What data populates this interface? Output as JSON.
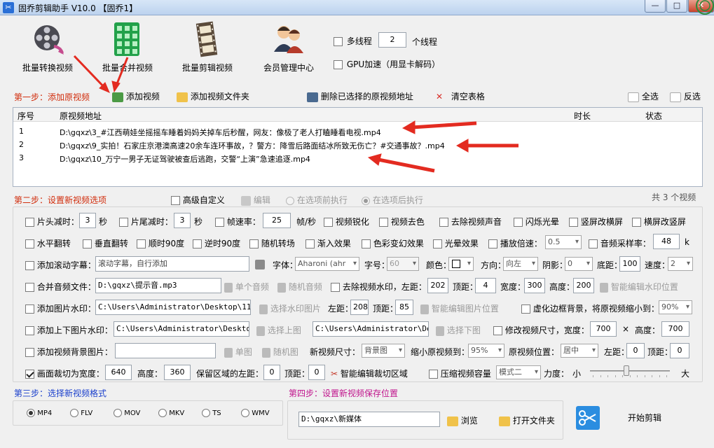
{
  "window": {
    "title": "固乔剪辑助手 V10.0  【固乔1】"
  },
  "toolbar": {
    "batch_convert": "批量转换视频",
    "batch_merge": "批量合并视频",
    "batch_edit": "批量剪辑视频",
    "member_center": "会员管理中心",
    "multithread_label": "多线程",
    "thread_count": "2",
    "thread_unit": "个线程",
    "gpu_label": "GPU加速（用显卡解码）"
  },
  "step1": {
    "title": "第一步：添加原视频",
    "add_video": "添加视频",
    "add_folder": "添加视频文件夹",
    "delete_selected": "删除已选择的原视频地址",
    "clear_table": "清空表格",
    "select_all": "全选",
    "invert": "反选"
  },
  "table": {
    "headers": {
      "index": "序号",
      "path": "原视频地址",
      "duration": "时长",
      "status": "状态"
    },
    "rows": [
      {
        "index": "1",
        "path": "D:\\gqxz\\3_#江西萌娃坐摇摇车睡着妈妈关掉车后秒醒，网友：像极了老人打瞌睡看电视.mp4",
        "duration": "",
        "status": ""
      },
      {
        "index": "2",
        "path": "D:\\gqxz\\9_实拍！石家庄京港澳高速20余车连环事故，？警方：降雪后路面结冰所致无伤亡？#交通事故？.mp4",
        "duration": "",
        "status": ""
      },
      {
        "index": "3",
        "path": "D:\\gqxz\\10_万宁一男子无证驾驶被查后逃跑，交警“上演”急速追逐.mp4",
        "duration": "",
        "status": ""
      }
    ]
  },
  "step2": {
    "title": "第二步：设置新视频选项",
    "advanced": "高级自定义",
    "edit": "编辑",
    "before": "在选项前执行",
    "after": "在选项后执行",
    "total": "共 3 个视频"
  },
  "options": {
    "head_cut": "片头减时：",
    "head_val": "3",
    "sec1": "秒",
    "tail_cut": "片尾减时：",
    "tail_val": "3",
    "sec2": "秒",
    "fps": "帧速率：",
    "fps_val": "25",
    "fps_unit": "帧/秒",
    "sharpen": "视频锐化",
    "decolor": "视频去色",
    "remove_audio": "去除视频声音",
    "flash": "闪烁光晕",
    "v2h": "竖屏改横屏",
    "h2v": "横屏改竖屏",
    "hflip": "水平翻转",
    "vflip": "垂直翻转",
    "rot90cw": "顺时90度",
    "rot90ccw": "逆时90度",
    "random_rotate": "随机转场",
    "fade_in": "渐入效果",
    "color_effect": "色彩变幻效果",
    "halo": "光晕效果",
    "speed": "播放倍速：",
    "speed_val": "0.5",
    "sample_rate": "音频采样率：",
    "sample_val": "48",
    "sample_unit": "k",
    "scroll_sub": "添加滚动字幕：",
    "scroll_text": "滚动字幕，自行添加",
    "font": "字体：",
    "font_val": "Aharoni (ahr",
    "fontsize": "字号：",
    "fontsize_val": "60",
    "color": "颜色：",
    "direction": "方向：",
    "direction_val": "向左",
    "shadow": "阴影：",
    "shadow_val": "0",
    "bottom": "底距：",
    "bottom_val": "100",
    "speed2": "速度：",
    "speed2_val": "2",
    "merge_audio": "合并音频文件：",
    "merge_audio_path": "D:\\gqxz\\提示音.mp3",
    "single_audio": "单个音频",
    "random_audio": "随机音频",
    "remove_watermark": "去除视频水印，左距：",
    "wm_left": "202",
    "wm_top_label": "顶距：",
    "wm_top": "4",
    "wm_width_label": "宽度：",
    "wm_width": "300",
    "wm_height_label": "高度：",
    "wm_height": "200",
    "smart_wm": "智能编辑水印位置",
    "img_wm": "添加图片水印：",
    "img_wm_path": "C:\\Users\\Administrator\\Desktop\\111.j",
    "choose_wm_img": "选择水印图片",
    "img_left_label": "左距：",
    "img_left": "208",
    "img_top_label": "顶距：",
    "img_top": "85",
    "smart_img": "智能编辑图片位置",
    "blur_border": "虚化边框背景，将原视频缩小到：",
    "blur_val": "90%",
    "tb_wm": "添加上下图片水印：",
    "top_img_path": "C:\\Users\\Administrator\\Desktop\\i",
    "choose_top": "选择上图",
    "bottom_img_path": "C:\\Users\\Administrator\\Desk",
    "choose_bottom": "选择下图",
    "resize": "修改视频尺寸，宽度：",
    "resize_w": "700",
    "times": "×",
    "resize_h_label": "高度：",
    "resize_h": "700",
    "bg_img": "添加视频背景图片：",
    "bg_path": "",
    "single_img": "单图",
    "random_img": "随机图",
    "new_size": "新视频尺寸：",
    "new_size_val": "背景图",
    "shrink": "缩小原视频到：",
    "shrink_val": "95%",
    "orig_pos": "原视频位置：",
    "orig_pos_val": "居中",
    "left_label": "左距：",
    "left_val": "0",
    "top_label": "顶距：",
    "top_val": "0",
    "crop": "画面裁切为宽度：",
    "crop_w": "640",
    "crop_h_label": "高度：",
    "crop_h": "360",
    "keep_left": "保留区域的左距：",
    "keep_left_val": "0",
    "keep_top_label": "顶距：",
    "keep_top_val": "0",
    "smart_crop": "智能编辑裁切区域",
    "compress": "压缩视频容量",
    "compress_mode": "模式二",
    "strength": "力度：",
    "small": "小",
    "large": "大",
    "strength_level": 0.45
  },
  "step3": {
    "title": "第三步：选择新视频格式",
    "formats": [
      "MP4",
      "FLV",
      "MOV",
      "MKV",
      "TS",
      "WMV"
    ],
    "selected": "MP4"
  },
  "step4": {
    "title": "第四步：设置新视频保存位置",
    "path": "D:\\gqxz\\新媒体",
    "browse": "浏览",
    "open_folder": "打开文件夹"
  },
  "start": {
    "label": "开始剪辑"
  },
  "colors": {
    "red": "#d12d0c",
    "magenta": "#c0148c",
    "blue": "#1a3fcc"
  }
}
